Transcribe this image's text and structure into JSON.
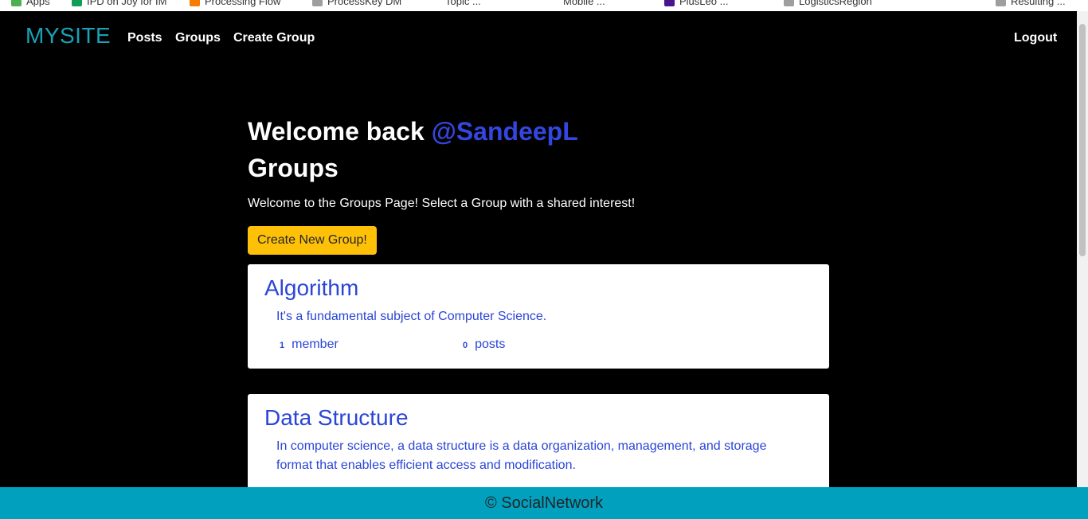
{
  "bookmarks": [
    {
      "label": "Apps",
      "color": "#4caf50"
    },
    {
      "label": "IPD on Joy for IM",
      "color": "#0f9d58"
    },
    {
      "label": "Processing Flow",
      "color": "#f57c00"
    },
    {
      "label": "ProcessKey DM",
      "color": "#9e9e9e"
    },
    {
      "label": "Topic ...",
      "color": "#ffffff"
    },
    {
      "label": "Mobile ...",
      "color": "#ffffff"
    },
    {
      "label": "PlusLeo ...",
      "color": "#4a148c"
    },
    {
      "label": "LogisticsRegion",
      "color": "#9e9e9e"
    },
    {
      "label": "Resulting ...",
      "color": "#9e9e9e"
    }
  ],
  "navbar": {
    "brand": "MYSITE",
    "links": [
      "Posts",
      "Groups",
      "Create Group"
    ],
    "logout": "Logout"
  },
  "welcome": {
    "prefix": "Welcome back",
    "username": "@SandeepL"
  },
  "page": {
    "heading": "Groups",
    "intro": "Welcome to the Groups Page! Select a Group with a shared interest!",
    "create_button": "Create New Group!"
  },
  "groups": [
    {
      "title": "Algorithm",
      "description": "It's a fundamental subject of Computer Science.",
      "members_count": "1",
      "members_label": "member",
      "posts_count": "0",
      "posts_label": "posts"
    },
    {
      "title": "Data Structure",
      "description": "In computer science, a data structure is a data organization, management, and storage format that enables efficient access and modification."
    }
  ],
  "footer": {
    "text": "© SocialNetwork"
  },
  "colors": {
    "brand": "#17a2b8",
    "link_blue": "#2a45d6",
    "button_yellow": "#ffc107",
    "footer_bg": "#00a0be"
  }
}
